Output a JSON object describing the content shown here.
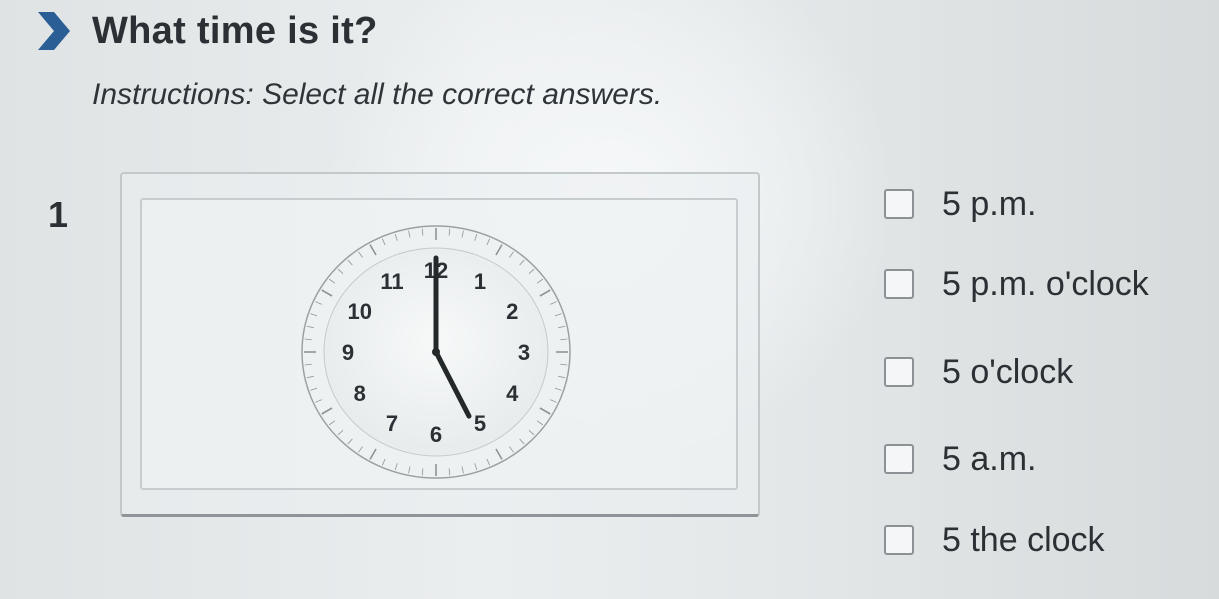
{
  "header": {
    "title": "What time is it?",
    "icon": "chevron-right-icon",
    "icon_color": "#2a5e95"
  },
  "instructions": "Instructions: Select all the correct answers.",
  "question": {
    "number": "1",
    "clock": {
      "numbers": [
        "12",
        "1",
        "2",
        "3",
        "4",
        "5",
        "6",
        "7",
        "8",
        "9",
        "10",
        "11"
      ],
      "hour_hand_points_to": 5,
      "minute_hand_points_to": 12,
      "time_shown": "5:00"
    },
    "options": [
      {
        "label": "5 p.m.",
        "checked": false
      },
      {
        "label": "5 p.m. o'clock",
        "checked": false
      },
      {
        "label": "5 o'clock",
        "checked": false
      },
      {
        "label": "5 a.m.",
        "checked": false
      },
      {
        "label": "5 the clock",
        "checked": false
      }
    ]
  }
}
